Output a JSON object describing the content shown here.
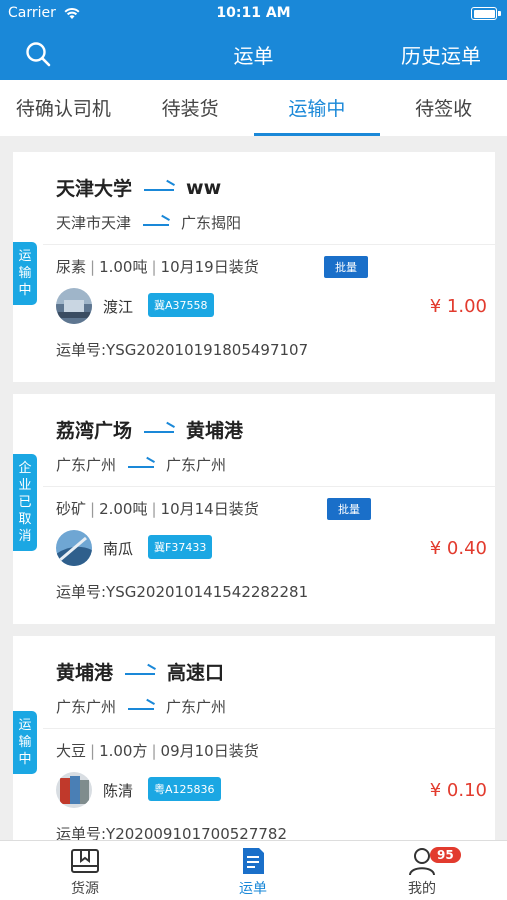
{
  "status_bar": {
    "carrier": "Carrier",
    "time": "10:11 AM"
  },
  "nav": {
    "title": "运单",
    "right_action": "历史运单",
    "search_icon": "search-icon"
  },
  "tabs": [
    {
      "label": "待确认司机",
      "active": false
    },
    {
      "label": "待装货",
      "active": false
    },
    {
      "label": "运输中",
      "active": true
    },
    {
      "label": "待签收",
      "active": false
    }
  ],
  "waybills": [
    {
      "status": "运输中",
      "from": "天津大学",
      "to": "ww",
      "from_region": "天津市天津",
      "to_region": "广东揭阳",
      "cargo": "尿素",
      "weight": "1.00吨",
      "load_date": "10月19日装货",
      "batch_tag": "批量",
      "driver": "渡江",
      "plate": "冀A37558",
      "price": "¥ 1.00",
      "waybill_no": "运单号:YSG202010191805497107"
    },
    {
      "status": "企业已取消",
      "from": "荔湾广场",
      "to": "黄埔港",
      "from_region": "广东广州",
      "to_region": "广东广州",
      "cargo": "砂矿",
      "weight": "2.00吨",
      "load_date": "10月14日装货",
      "batch_tag": "批量",
      "driver": "南瓜",
      "plate": "冀F37433",
      "price": "¥ 0.40",
      "waybill_no": "运单号:YSG202010141542282281"
    },
    {
      "status": "运输中",
      "from": "黄埔港",
      "to": "高速口",
      "from_region": "广东广州",
      "to_region": "广东广州",
      "cargo": "大豆",
      "weight": "1.00方",
      "load_date": "09月10日装货",
      "batch_tag": "",
      "driver": "陈清",
      "plate": "粤A125836",
      "price": "¥ 0.10",
      "waybill_no": "运单号:Y202009101700527782"
    }
  ],
  "bottom_tabs": [
    {
      "label": "货源",
      "icon": "cargo-box-icon",
      "active": false
    },
    {
      "label": "运单",
      "icon": "waybill-document-icon",
      "active": true
    },
    {
      "label": "我的",
      "icon": "user-profile-icon",
      "active": false,
      "badge": "95"
    }
  ],
  "colors": {
    "primary": "#1a88d8",
    "badge": "#1ba7e3",
    "price": "#e23b2e",
    "batch": "#1a6fc9"
  }
}
